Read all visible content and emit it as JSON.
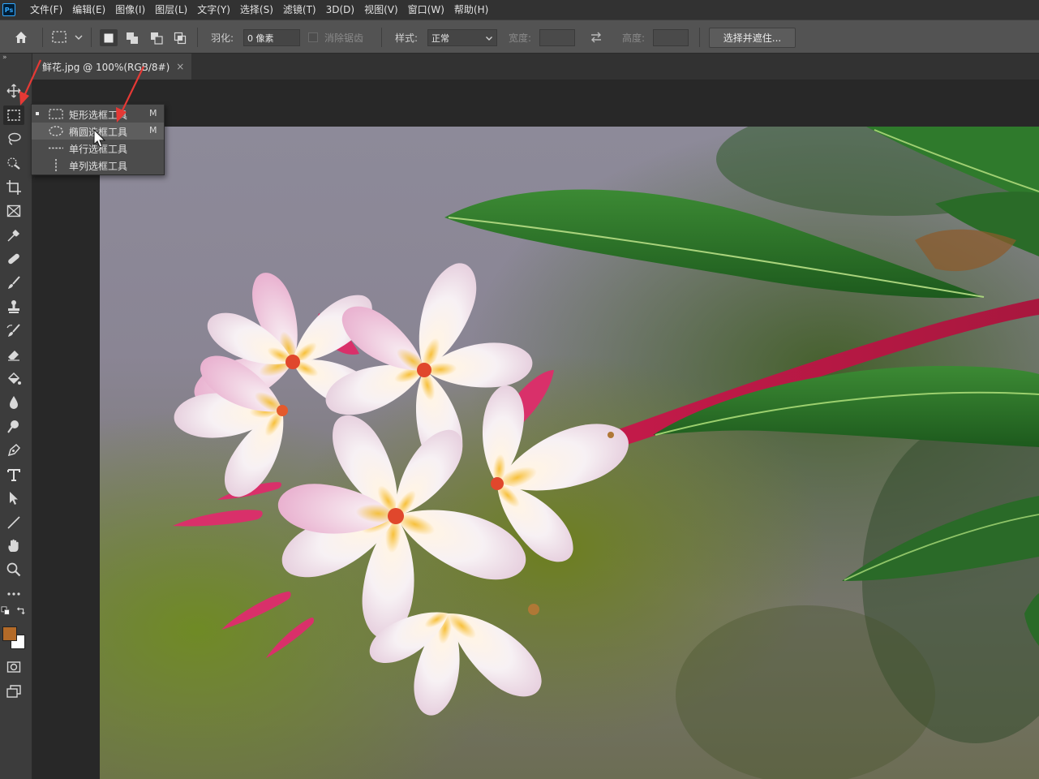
{
  "app": {
    "logo": "Ps"
  },
  "menu": [
    "文件(F)",
    "编辑(E)",
    "图像(I)",
    "图层(L)",
    "文字(Y)",
    "选择(S)",
    "滤镜(T)",
    "3D(D)",
    "视图(V)",
    "窗口(W)",
    "帮助(H)"
  ],
  "options": {
    "feather_label": "羽化:",
    "feather_value": "0 像素",
    "antialias_label": "消除锯齿",
    "style_label": "样式:",
    "style_value": "正常",
    "width_label": "宽度:",
    "height_label": "高度:",
    "select_mask_button": "选择并遮住..."
  },
  "document": {
    "tab_title": "鲜花.jpg @ 100%(RGB/8#)",
    "close": "×"
  },
  "toolbar": {
    "collapse": "»"
  },
  "flyout": {
    "items": [
      {
        "label": "矩形选框工具",
        "key": "M",
        "icon": "rect-marquee-icon",
        "selected": true
      },
      {
        "label": "椭圆选框工具",
        "key": "M",
        "icon": "ellipse-marquee-icon",
        "hover": true
      },
      {
        "label": "单行选框工具",
        "key": "",
        "icon": "single-row-marquee-icon"
      },
      {
        "label": "单列选框工具",
        "key": "",
        "icon": "single-column-marquee-icon"
      }
    ]
  },
  "colors": {
    "foreground": "#b36a28",
    "background": "#ffffff",
    "annotation": "#e53935"
  }
}
